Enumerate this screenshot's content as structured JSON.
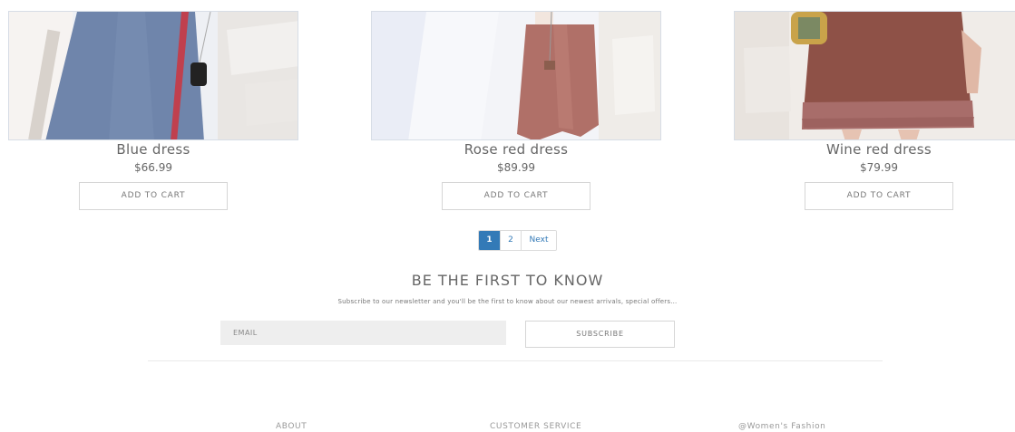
{
  "products": [
    {
      "name": "Blue dress",
      "price": "$66.99",
      "cart_label": "ADD TO CART"
    },
    {
      "name": "Rose red dress",
      "price": "$89.99",
      "cart_label": "ADD TO CART"
    },
    {
      "name": "Wine red dress",
      "price": "$79.99",
      "cart_label": "ADD TO CART"
    }
  ],
  "pagination": {
    "pages": [
      "1",
      "2"
    ],
    "active": "1",
    "next_label": "Next"
  },
  "newsletter": {
    "title": "BE THE FIRST TO KNOW",
    "subtitle": "Subscribe to our newsletter and you'll be the first to know about our newest arrivals, special offers...",
    "email_placeholder": "EMAIL",
    "subscribe_label": "SUBSCRIBE"
  },
  "footer": {
    "about": "ABOUT",
    "customer_service": "CUSTOMER SERVICE",
    "brand": "@Women's Fashion"
  },
  "colors": {
    "accent": "#337ab7",
    "blue_dress": "#6f85ab",
    "rose_dress": "#b07068",
    "wine_dress": "#8e5147"
  }
}
